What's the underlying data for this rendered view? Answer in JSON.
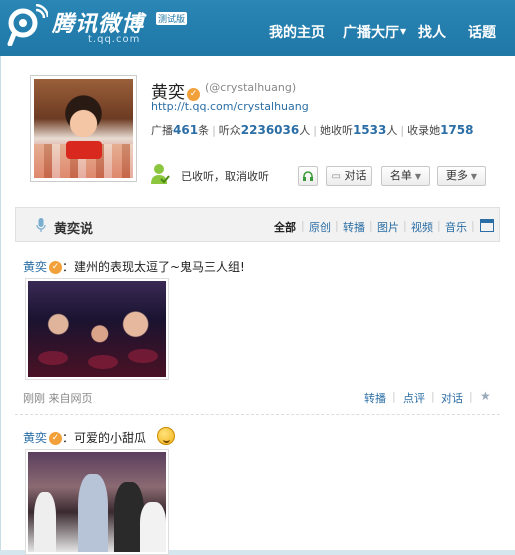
{
  "app": {
    "logo_text": "腾讯微博",
    "logo_badge": "测试版",
    "logo_url": "t.qq.com"
  },
  "nav": {
    "items": [
      {
        "label": "我的主页"
      },
      {
        "label": "广播大厅",
        "has_dropdown": true
      },
      {
        "label": "找人"
      },
      {
        "label": "话题"
      }
    ]
  },
  "profile": {
    "name": "黄奕",
    "handle": "(@crystalhuang)",
    "url": "http://t.qq.com/crystalhuang",
    "stats": {
      "broadcast_label": "广播",
      "broadcast_count": "461",
      "broadcast_unit": "条",
      "listeners_label": "听众",
      "listeners_count": "2236036",
      "listeners_unit": "人",
      "following_label": "她收听",
      "following_count": "1533",
      "following_unit": "人",
      "collected_label": "收录她",
      "collected_count": "1758"
    },
    "follow_status": "已收听，取消收听",
    "buttons": {
      "dialog": "对话",
      "list": "名单",
      "more": "更多"
    }
  },
  "feed": {
    "title": "黄奕说",
    "filters": [
      "全部",
      "原创",
      "转播",
      "图片",
      "视频",
      "音乐"
    ],
    "active_filter": "全部"
  },
  "posts": [
    {
      "author": "黄奕",
      "text": "：建州的表现太逗了~鬼马三人组!",
      "meta": "刚刚  来自网页",
      "actions": [
        "转播",
        "点评",
        "对话"
      ]
    },
    {
      "author": "黄奕",
      "text": "：可爱的小甜瓜"
    }
  ],
  "colors": {
    "header_bg": "#1f77a6",
    "link": "#2b6ea5",
    "verified": "#f2a13a"
  }
}
